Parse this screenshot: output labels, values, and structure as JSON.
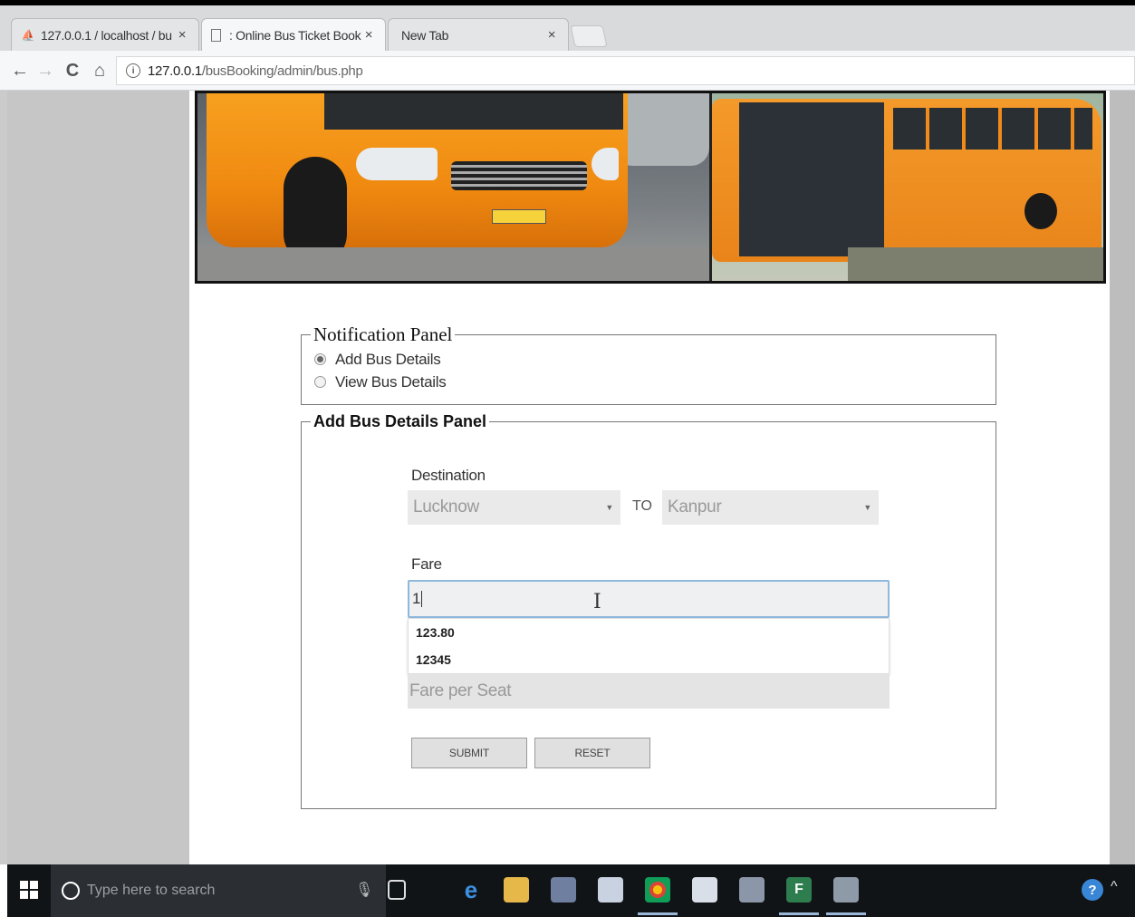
{
  "browser": {
    "tabs": [
      {
        "title": "127.0.0.1 / localhost / bu",
        "close": "×"
      },
      {
        "title": ": Online Bus Ticket Booki",
        "close": "×"
      },
      {
        "title": "New Tab",
        "close": "×"
      }
    ],
    "address": {
      "host": "127.0.0.1",
      "path": "/busBooking/admin/bus.php"
    },
    "nav": {
      "back": "←",
      "forward": "→",
      "reload": "C",
      "home": "⌂"
    }
  },
  "notification_panel": {
    "legend": "Notification Panel",
    "options": [
      {
        "label": "Add Bus Details",
        "selected": true
      },
      {
        "label": "View Bus Details",
        "selected": false
      }
    ]
  },
  "add_panel": {
    "legend": "Add Bus Details Panel",
    "destination_label": "Destination",
    "from_value": "Lucknow",
    "to_label": "TO",
    "to_value": "Kanpur",
    "fare_label": "Fare",
    "fare_value": "1",
    "autocomplete": [
      "123.80",
      "12345"
    ],
    "fare_seat_placeholder": "Fare per Seat",
    "submit_label": "SUBMIT",
    "reset_label": "RESET"
  },
  "taskbar": {
    "search_placeholder": "Type here to search",
    "help": "?",
    "tray_chevron": "^"
  },
  "colors": {
    "accent_orange": "#f08a10",
    "focus_border": "#8fb8dd",
    "taskbar": "#111417"
  }
}
